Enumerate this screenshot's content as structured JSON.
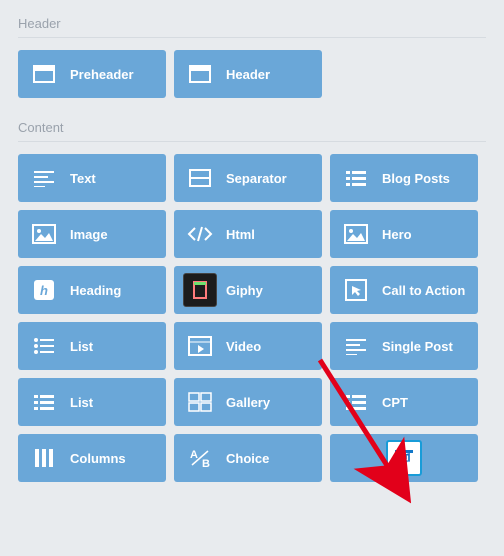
{
  "sections": {
    "header": {
      "title": "Header",
      "items": [
        {
          "id": "preheader",
          "label": "Preheader",
          "icon": "window"
        },
        {
          "id": "header",
          "label": "Header",
          "icon": "window"
        }
      ]
    },
    "content": {
      "title": "Content",
      "items": [
        {
          "id": "text",
          "label": "Text",
          "icon": "align-left"
        },
        {
          "id": "separator",
          "label": "Separator",
          "icon": "window"
        },
        {
          "id": "blog-posts",
          "label": "Blog Posts",
          "icon": "list-thick"
        },
        {
          "id": "image",
          "label": "Image",
          "icon": "image"
        },
        {
          "id": "html",
          "label": "Html",
          "icon": "code"
        },
        {
          "id": "hero",
          "label": "Hero",
          "icon": "image"
        },
        {
          "id": "heading",
          "label": "Heading",
          "icon": "h-box"
        },
        {
          "id": "giphy",
          "label": "Giphy",
          "icon": "giphy"
        },
        {
          "id": "cta",
          "label": "Call to Action",
          "icon": "cursor-box"
        },
        {
          "id": "list",
          "label": "List",
          "icon": "list"
        },
        {
          "id": "video",
          "label": "Video",
          "icon": "video"
        },
        {
          "id": "single-post",
          "label": "Single Post",
          "icon": "align-left"
        },
        {
          "id": "list2",
          "label": "List",
          "icon": "list-thick"
        },
        {
          "id": "gallery",
          "label": "Gallery",
          "icon": "gallery"
        },
        {
          "id": "cpt",
          "label": "CPT",
          "icon": "list-thick"
        },
        {
          "id": "columns",
          "label": "Columns",
          "icon": "columns"
        },
        {
          "id": "choice",
          "label": "Choice",
          "icon": "ab"
        },
        {
          "id": "event",
          "label": "",
          "icon": "event"
        }
      ]
    }
  }
}
